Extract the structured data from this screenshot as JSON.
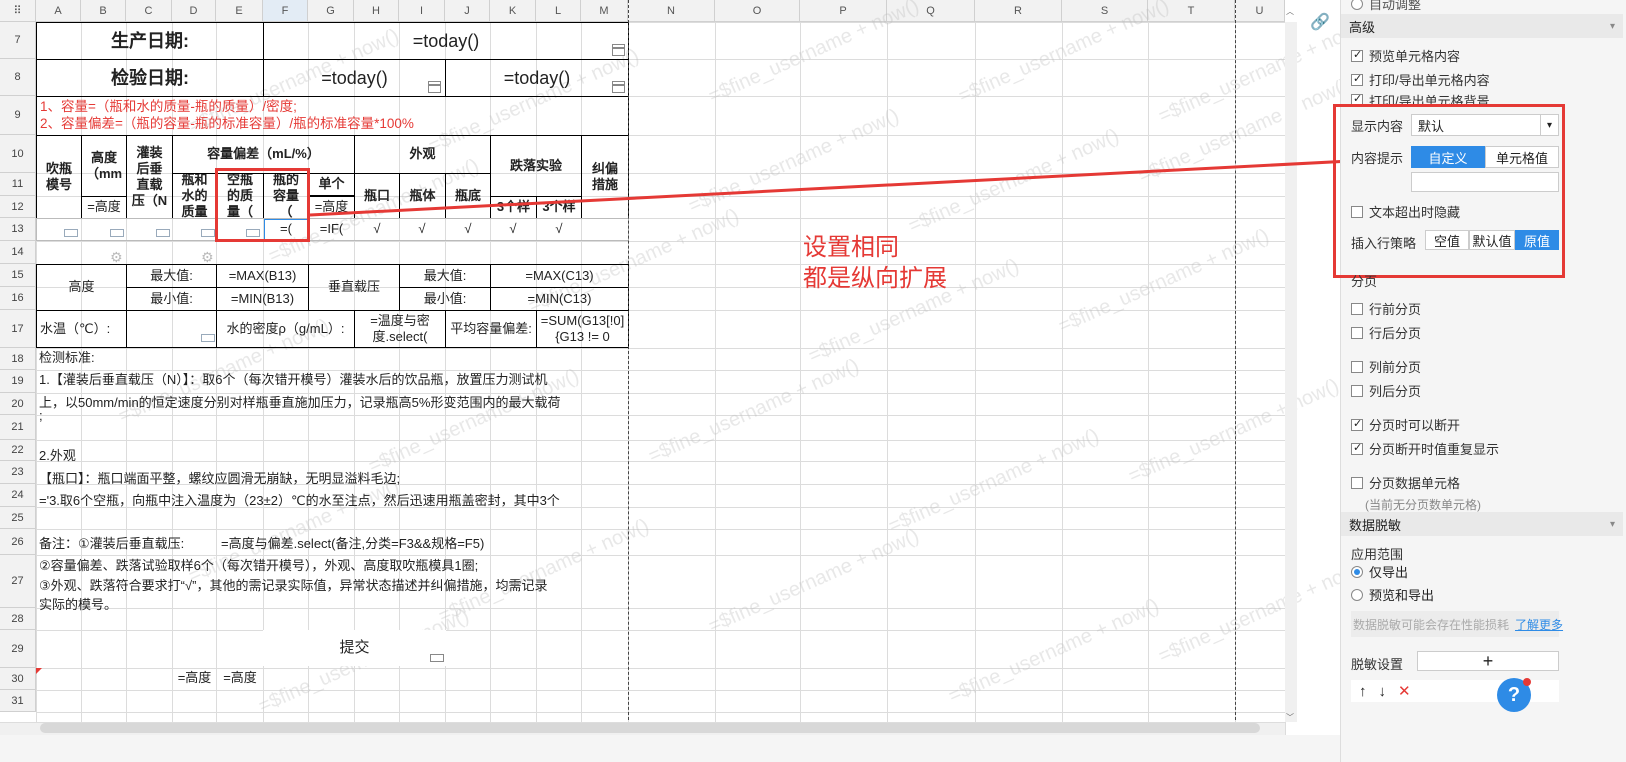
{
  "columns": [
    "A",
    "B",
    "C",
    "D",
    "E",
    "F",
    "G",
    "H",
    "I",
    "J",
    "K",
    "L",
    "M",
    "N",
    "O",
    "P",
    "Q",
    "R",
    "S",
    "T",
    "U"
  ],
  "rows": [
    "7",
    "8",
    "9",
    "10",
    "11",
    "12",
    "13",
    "14",
    "15",
    "16",
    "17",
    "18",
    "19",
    "20",
    "21",
    "22",
    "23",
    "24",
    "25",
    "26",
    "27",
    "28",
    "29",
    "30",
    "31"
  ],
  "cells": {
    "prod_label": "生产日期:",
    "prod_value": "=today()",
    "insp_label": "检验日期:",
    "insp_value1": "=today()",
    "insp_value2": "=today()",
    "note1": "1、容量=（瓶和水的质量-瓶的质量）/密度;",
    "note2": "2、容量偏差=（瓶的容量-瓶的标准容量）/瓶的标准容量*100%",
    "h_mold": "吹瓶模号",
    "h_height": "高度（mm",
    "h_load": "灌装后垂直载压（N",
    "h_dev": "容量偏差（mL/%）",
    "h_appear": "外观",
    "h_drop": "跌落实验",
    "h_fix": "纠偏措施",
    "h_bottle_water": "瓶和水的质量",
    "h_empty": "空瓶的质量（",
    "h_capacity": "瓶的容量（",
    "h_single": "单个",
    "h_mouth": "瓶口",
    "h_body": "瓶体",
    "h_bottom": "瓶底",
    "r12_height": "=高度",
    "r12_single": "=高度",
    "r12_drop1": "3个样",
    "r12_drop2": "3个样",
    "r13_f": "=(",
    "r13_g": "=IF(",
    "check": "√",
    "height_label": "高度",
    "max_label": "最大值:",
    "min_label": "最小值:",
    "max_b": "=MAX(B13)",
    "min_b": "=MIN(B13)",
    "vload_label": "垂直载压",
    "max_c": "=MAX(C13)",
    "min_c": "=MIN(C13)",
    "water_temp": "水温（℃）:",
    "density": "水的密度ρ（g/mL）:",
    "density_val": "=温度与密度.select(",
    "avg_dev": "平均容量偏差:",
    "avg_val": "=SUM(G13[!0]{G13 != 0",
    "std_title": "检测标准:",
    "std1": "1.【灌装后垂直载压（N）】：取6个（每次错开模号）灌装水后的饮品瓶，放置压力测试机",
    "std1b": "上，以50mm/min的恒定速度分别对样瓶垂直施加压力，记录瓶高5%形变范围内的最大载荷",
    "std1c": ";",
    "std2": "2.外观",
    "std2a": "【瓶口】：瓶口端面平整，螺纹应圆滑无崩缺，无明显溢料毛边;",
    "std3": "='3.取6个空瓶，向瓶中注入温度为（23±2）℃的水至注点，然后迅速用瓶盖密封，其中3个",
    "remark1_label": "备注：①灌装后垂直载压:",
    "remark1_val": "=高度与偏差.select(备注,分类=F3&&规格=F5)",
    "remark2": "②容量偏差、跌落试验取样6个（每次错开模号），外观、高度取吹瓶模具1圈;",
    "remark3": "③外观、跌落符合要求打“√”，其他的需记录实际值，异常状态描述并纠偏措施，均需记录",
    "remark4": "实际的模号。",
    "submit": "提交",
    "r30_d": "=高度",
    "r30_e": "=高度"
  },
  "annotation": {
    "line1": "设置相同",
    "line2": "都是纵向扩展"
  },
  "watermark": "=$fine_username + now()",
  "panel": {
    "top_text": "自动调整",
    "advanced": "高级",
    "preview": "预览单元格内容",
    "print": "打印/导出单元格内容",
    "print_bg": "打印/导出单元格背景",
    "display_label": "显示内容",
    "display_value": "默认",
    "tip_label": "内容提示",
    "tip_custom": "自定义",
    "tip_cell": "单元格值",
    "hide_overflow": "文本超出时隐藏",
    "insert_label": "插入行策略",
    "insert_empty": "空值",
    "insert_default": "默认值",
    "insert_orig": "原值",
    "paging": "分页",
    "before_row": "行前分页",
    "after_row": "行后分页",
    "before_col": "列前分页",
    "after_col": "列后分页",
    "can_break": "分页时可以断开",
    "repeat": "分页断开时值重复显示",
    "page_cell": "分页数据单元格",
    "no_page_cell": "(当前无分页数单元格)",
    "mask": "数据脱敏",
    "scope": "应用范围",
    "export_only": "仅导出",
    "preview_export": "预览和导出",
    "mask_hint": "数据脱敏可能会存在性能损耗",
    "learn_more": "了解更多",
    "mask_settings": "脱敏设置",
    "help": "?"
  },
  "colors": {
    "accent": "#2e8be6",
    "red": "#e53935"
  }
}
